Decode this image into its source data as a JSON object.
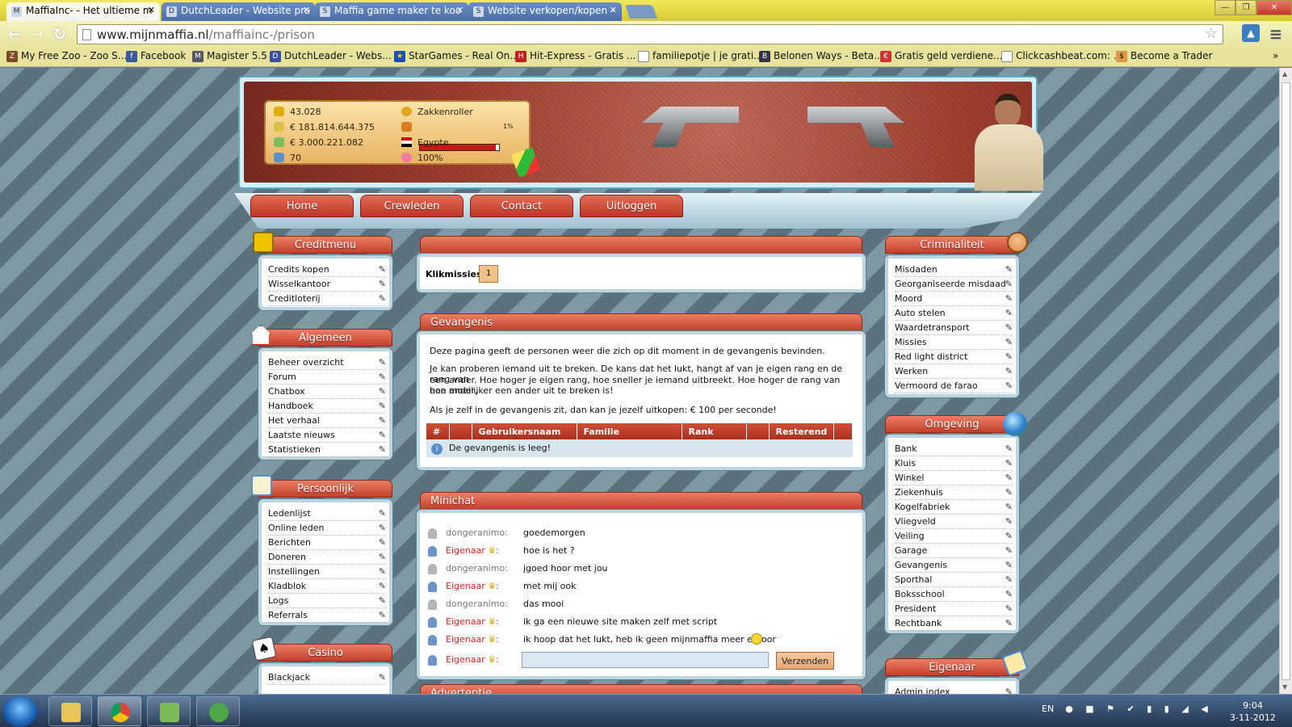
{
  "browser": {
    "tabs": [
      {
        "label": "MaffiaInc- - Het ultieme m",
        "active": true
      },
      {
        "label": "DutchLeader - Website pro",
        "active": false
      },
      {
        "label": "Maffia game maker te koo",
        "active": false
      },
      {
        "label": "Website verkopen/kopen -",
        "active": false
      }
    ],
    "url_domain": "www.mijnmaffia.nl",
    "url_path": "/maffiainc-/prison",
    "bookmarks": [
      "My Free Zoo - Zoo S...",
      "Facebook",
      "Magister 5.5",
      "DutchLeader - Webs...",
      "StarGames - Real On...",
      "Hit-Express - Gratis ...",
      "familiepotje | je grati...",
      "Belonen Ways - Beta...",
      "Gratis geld verdiene...",
      "Clickcashbeat.com: ...",
      "Become a Trader"
    ]
  },
  "header": {
    "stats_left": [
      "43.028",
      "€ 181.814.644.375",
      "€ 3.000.221.082",
      "70"
    ],
    "rank": "Zakkenroller",
    "progress_pct": 1,
    "progress_label": "1%",
    "country": "Egypte",
    "health": "100%"
  },
  "menu": [
    "Home",
    "Crewleden",
    "Contact",
    "Uitloggen"
  ],
  "left": {
    "creditmenu": {
      "title": "Creditmenu",
      "items": [
        "Credits kopen",
        "Wisselkantoor",
        "Creditloterij"
      ]
    },
    "algemeen": {
      "title": "Algemeen",
      "items": [
        "Beheer overzicht",
        "Forum",
        "Chatbox",
        "Handboek",
        "Het verhaal",
        "Laatste nieuws",
        "Statistieken"
      ]
    },
    "persoonlijk": {
      "title": "Persoonlijk",
      "items": [
        "Ledenlijst",
        "Online leden",
        "Berichten",
        "Doneren",
        "Instellingen",
        "Kladblok",
        "Logs",
        "Referrals"
      ]
    },
    "casino": {
      "title": "Casino",
      "items": [
        "Blackjack"
      ]
    }
  },
  "right": {
    "criminaliteit": {
      "title": "Criminaliteit",
      "items": [
        "Misdaden",
        "Georganiseerde misdaad",
        "Moord",
        "Auto stelen",
        "Waardetransport",
        "Missies",
        "Red light district",
        "Werken",
        "Vermoord de farao"
      ]
    },
    "omgeving": {
      "title": "Omgeving",
      "items": [
        "Bank",
        "Kluis",
        "Winkel",
        "Ziekenhuis",
        "Kogelfabriek",
        "Vliegveld",
        "Veiling",
        "Garage",
        "Gevangenis",
        "Sporthal",
        "Boksschool",
        "President",
        "Rechtbank"
      ]
    },
    "eigenaar": {
      "title": "Eigenaar",
      "items": [
        "Admin index"
      ]
    }
  },
  "klik": {
    "label": "Klikmissies",
    "count": "1"
  },
  "prison": {
    "title": "Gevangenis",
    "p1": "Deze pagina geeft de personen weer die zich op dit moment in de gevangenis bevinden.",
    "p2a": "Je kan proberen iemand uit te breken. De kans dat het lukt, hangt af van je eigen rang en de rang van",
    "p2b": "een ander. Hoe hoger je eigen rang, hoe sneller je iemand uitbreekt. Hoe hoger de rang van een ander,",
    "p2c": "hoe moeilijker een ander uit te breken is!",
    "p3": "Als je zelf in de gevangenis zit, dan kan je jezelf uitkopen: € 100 per seconde!",
    "columns": [
      "#",
      "Gebruikersnaam",
      "Familie",
      "Rank",
      "Resterend"
    ],
    "empty": "De gevangenis is leeg!"
  },
  "chat": {
    "title": "Minichat",
    "messages": [
      {
        "user": "dongeranimo",
        "owner": false,
        "text": "goedemorgen"
      },
      {
        "user": "Eigenaar",
        "owner": true,
        "text": "hoe is het ?"
      },
      {
        "user": "dongeranimo",
        "owner": false,
        "text": "jgoed hoor met jou"
      },
      {
        "user": "Eigenaar",
        "owner": true,
        "text": "met mij ook"
      },
      {
        "user": "dongeranimo",
        "owner": false,
        "text": "das mooi"
      },
      {
        "user": "Eigenaar",
        "owner": true,
        "text": "ik ga een nieuwe site maken zelf met script"
      },
      {
        "user": "Eigenaar",
        "owner": true,
        "text": "ik hoop dat het lukt, heb ik geen mijnmaffia meer ervoor"
      }
    ],
    "input_user": "Eigenaar",
    "send": "Verzenden"
  },
  "advert": "Advertentie",
  "taskbar": {
    "lang": "EN",
    "time": "9:04",
    "date": "3-11-2012"
  }
}
